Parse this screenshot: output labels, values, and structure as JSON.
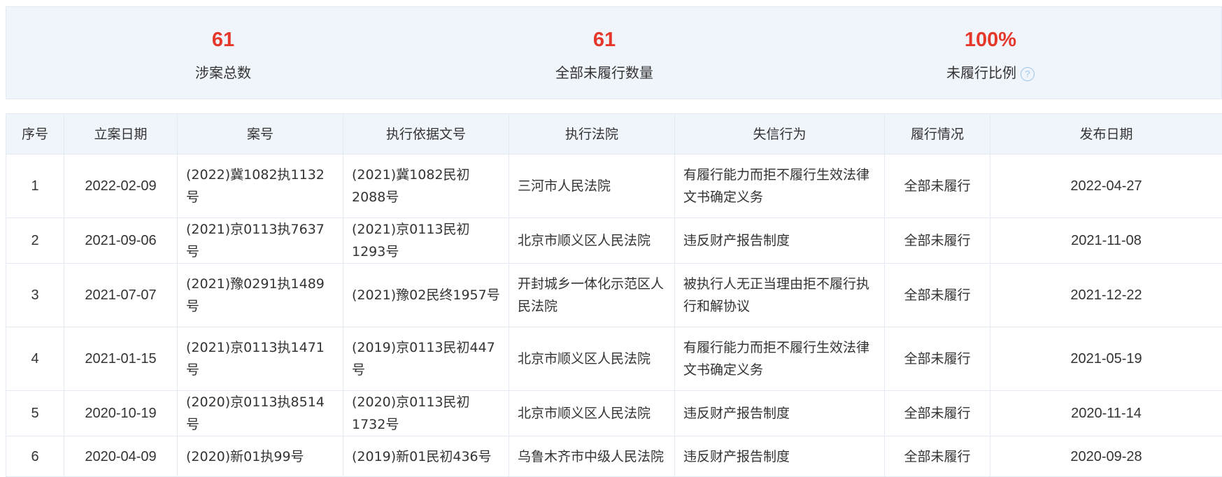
{
  "summary": {
    "total": {
      "value": "61",
      "label": "涉案总数"
    },
    "unfulfilled": {
      "value": "61",
      "label": "全部未履行数量"
    },
    "ratio": {
      "value": "100%",
      "label": "未履行比例",
      "help_icon": "question-circle-icon"
    }
  },
  "table": {
    "headers": [
      "序号",
      "立案日期",
      "案号",
      "执行依据文号",
      "执行法院",
      "失信行为",
      "履行情况",
      "发布日期"
    ],
    "rows": [
      [
        "1",
        "2022-02-09",
        "(2022)冀1082执1132号",
        "(2021)冀1082民初2088号",
        "三河市人民法院",
        "有履行能力而拒不履行生效法律文书确定义务",
        "全部未履行",
        "2022-04-27"
      ],
      [
        "2",
        "2021-09-06",
        "(2021)京0113执7637号",
        "(2021)京0113民初1293号",
        "北京市顺义区人民法院",
        "违反财产报告制度",
        "全部未履行",
        "2021-11-08"
      ],
      [
        "3",
        "2021-07-07",
        "(2021)豫0291执1489号",
        "(2021)豫02民终1957号",
        "开封城乡一体化示范区人民法院",
        "被执行人无正当理由拒不履行执行和解协议",
        "全部未履行",
        "2021-12-22"
      ],
      [
        "4",
        "2021-01-15",
        "(2021)京0113执1471号",
        "(2019)京0113民初447号",
        "北京市顺义区人民法院",
        "有履行能力而拒不履行生效法律文书确定义务",
        "全部未履行",
        "2021-05-19"
      ],
      [
        "5",
        "2020-10-19",
        "(2020)京0113执8514号",
        "(2020)京0113民初1732号",
        "北京市顺义区人民法院",
        "违反财产报告制度",
        "全部未履行",
        "2020-11-14"
      ],
      [
        "6",
        "2020-04-09",
        "(2020)新01执99号",
        "(2019)新01民初436号",
        "乌鲁木齐市中级人民法院",
        "违反财产报告制度",
        "全部未履行",
        "2020-09-28"
      ]
    ]
  },
  "colors": {
    "accent_red": "#e5372a",
    "header_bg": "#f0f5fc",
    "border": "#e3eaf4",
    "icon_blue": "#9ec6e8"
  }
}
